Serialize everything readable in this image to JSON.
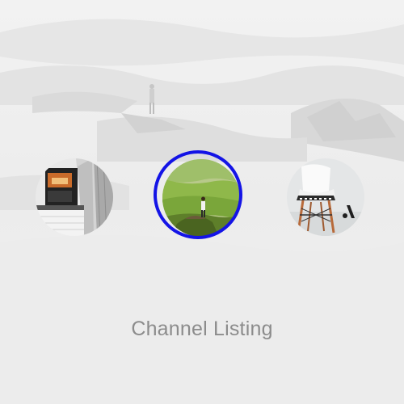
{
  "screen": {
    "title": "Channel Listing",
    "accent_color": "#1414e6",
    "background_color": "#efefef"
  },
  "channels": [
    {
      "name": "architecture-channel",
      "image": "building-interior-photo",
      "focused": false
    },
    {
      "name": "landscape-channel",
      "image": "hiker-on-green-hill-photo",
      "focused": true
    },
    {
      "name": "design-channel",
      "image": "white-chair-photo",
      "focused": false
    }
  ]
}
